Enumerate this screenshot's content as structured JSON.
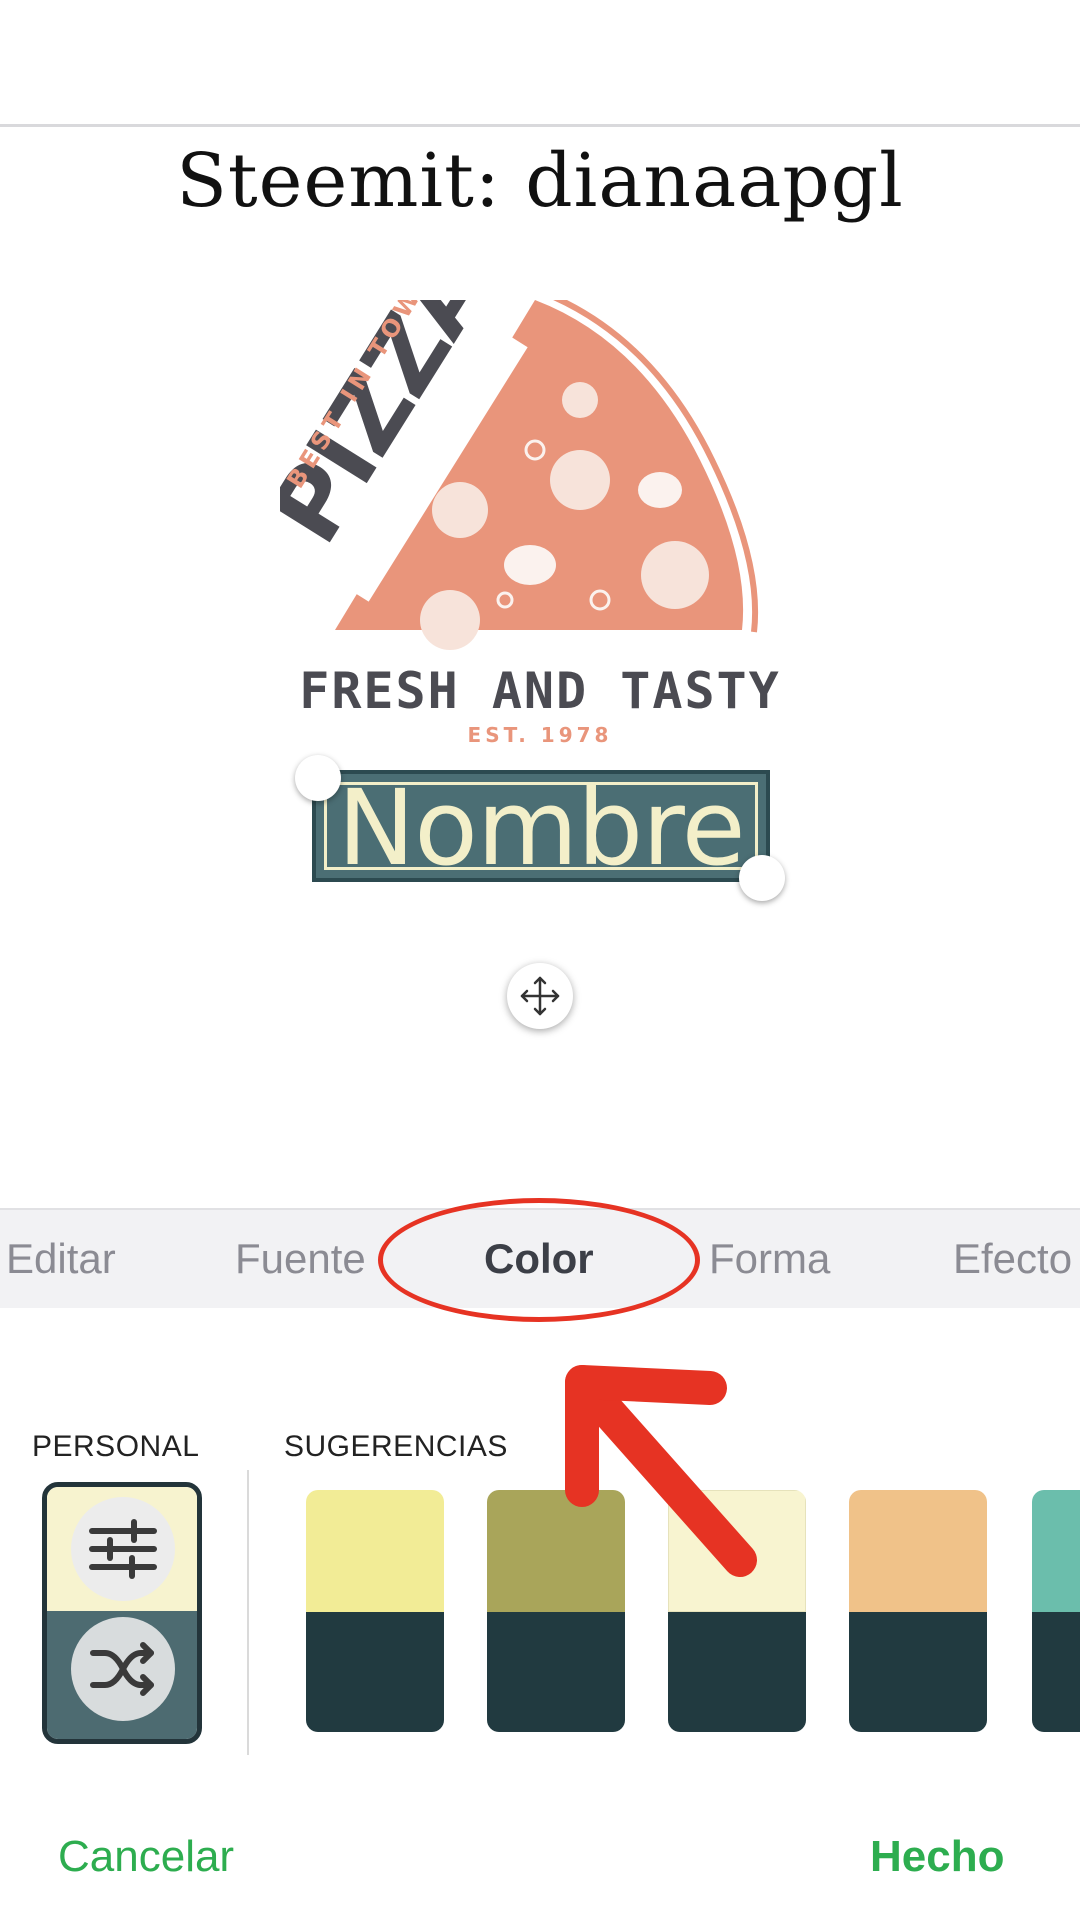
{
  "canvas": {
    "caption": "Steemit: dianaapgl",
    "logo": {
      "arc_text": "BEST IN TOWN",
      "main_word": "PIZZA",
      "tagline": "FRESH AND TASTY",
      "est": "EST.  1978"
    },
    "text_layer": "Nombre"
  },
  "tabs": [
    {
      "label": "Editar"
    },
    {
      "label": "Fuente"
    },
    {
      "label": "Color"
    },
    {
      "label": "Forma"
    },
    {
      "label": "Efecto"
    }
  ],
  "active_tab": "Color",
  "palette": {
    "personal_label": "PERSONAL",
    "suggestions_label": "SUGERENCIAS",
    "swatches": [
      {
        "top": "#f2ec96",
        "bottom": "#213a40"
      },
      {
        "top": "#a9a55a",
        "bottom": "#213a40"
      },
      {
        "top": "#f8f4d0",
        "bottom": "#213a40"
      },
      {
        "top": "#f0c289",
        "bottom": "#213a40"
      },
      {
        "top": "#6bbeac",
        "bottom": "#213a40"
      }
    ]
  },
  "footer": {
    "cancel": "Cancelar",
    "done": "Hecho"
  },
  "colors": {
    "accent_green": "#2dad4f",
    "annotation_red": "#e63323",
    "pizza_salmon": "#e9957b",
    "ink_gray": "#4b4b52",
    "label_bg": "#4b6e74",
    "label_text": "#f3efc9"
  }
}
